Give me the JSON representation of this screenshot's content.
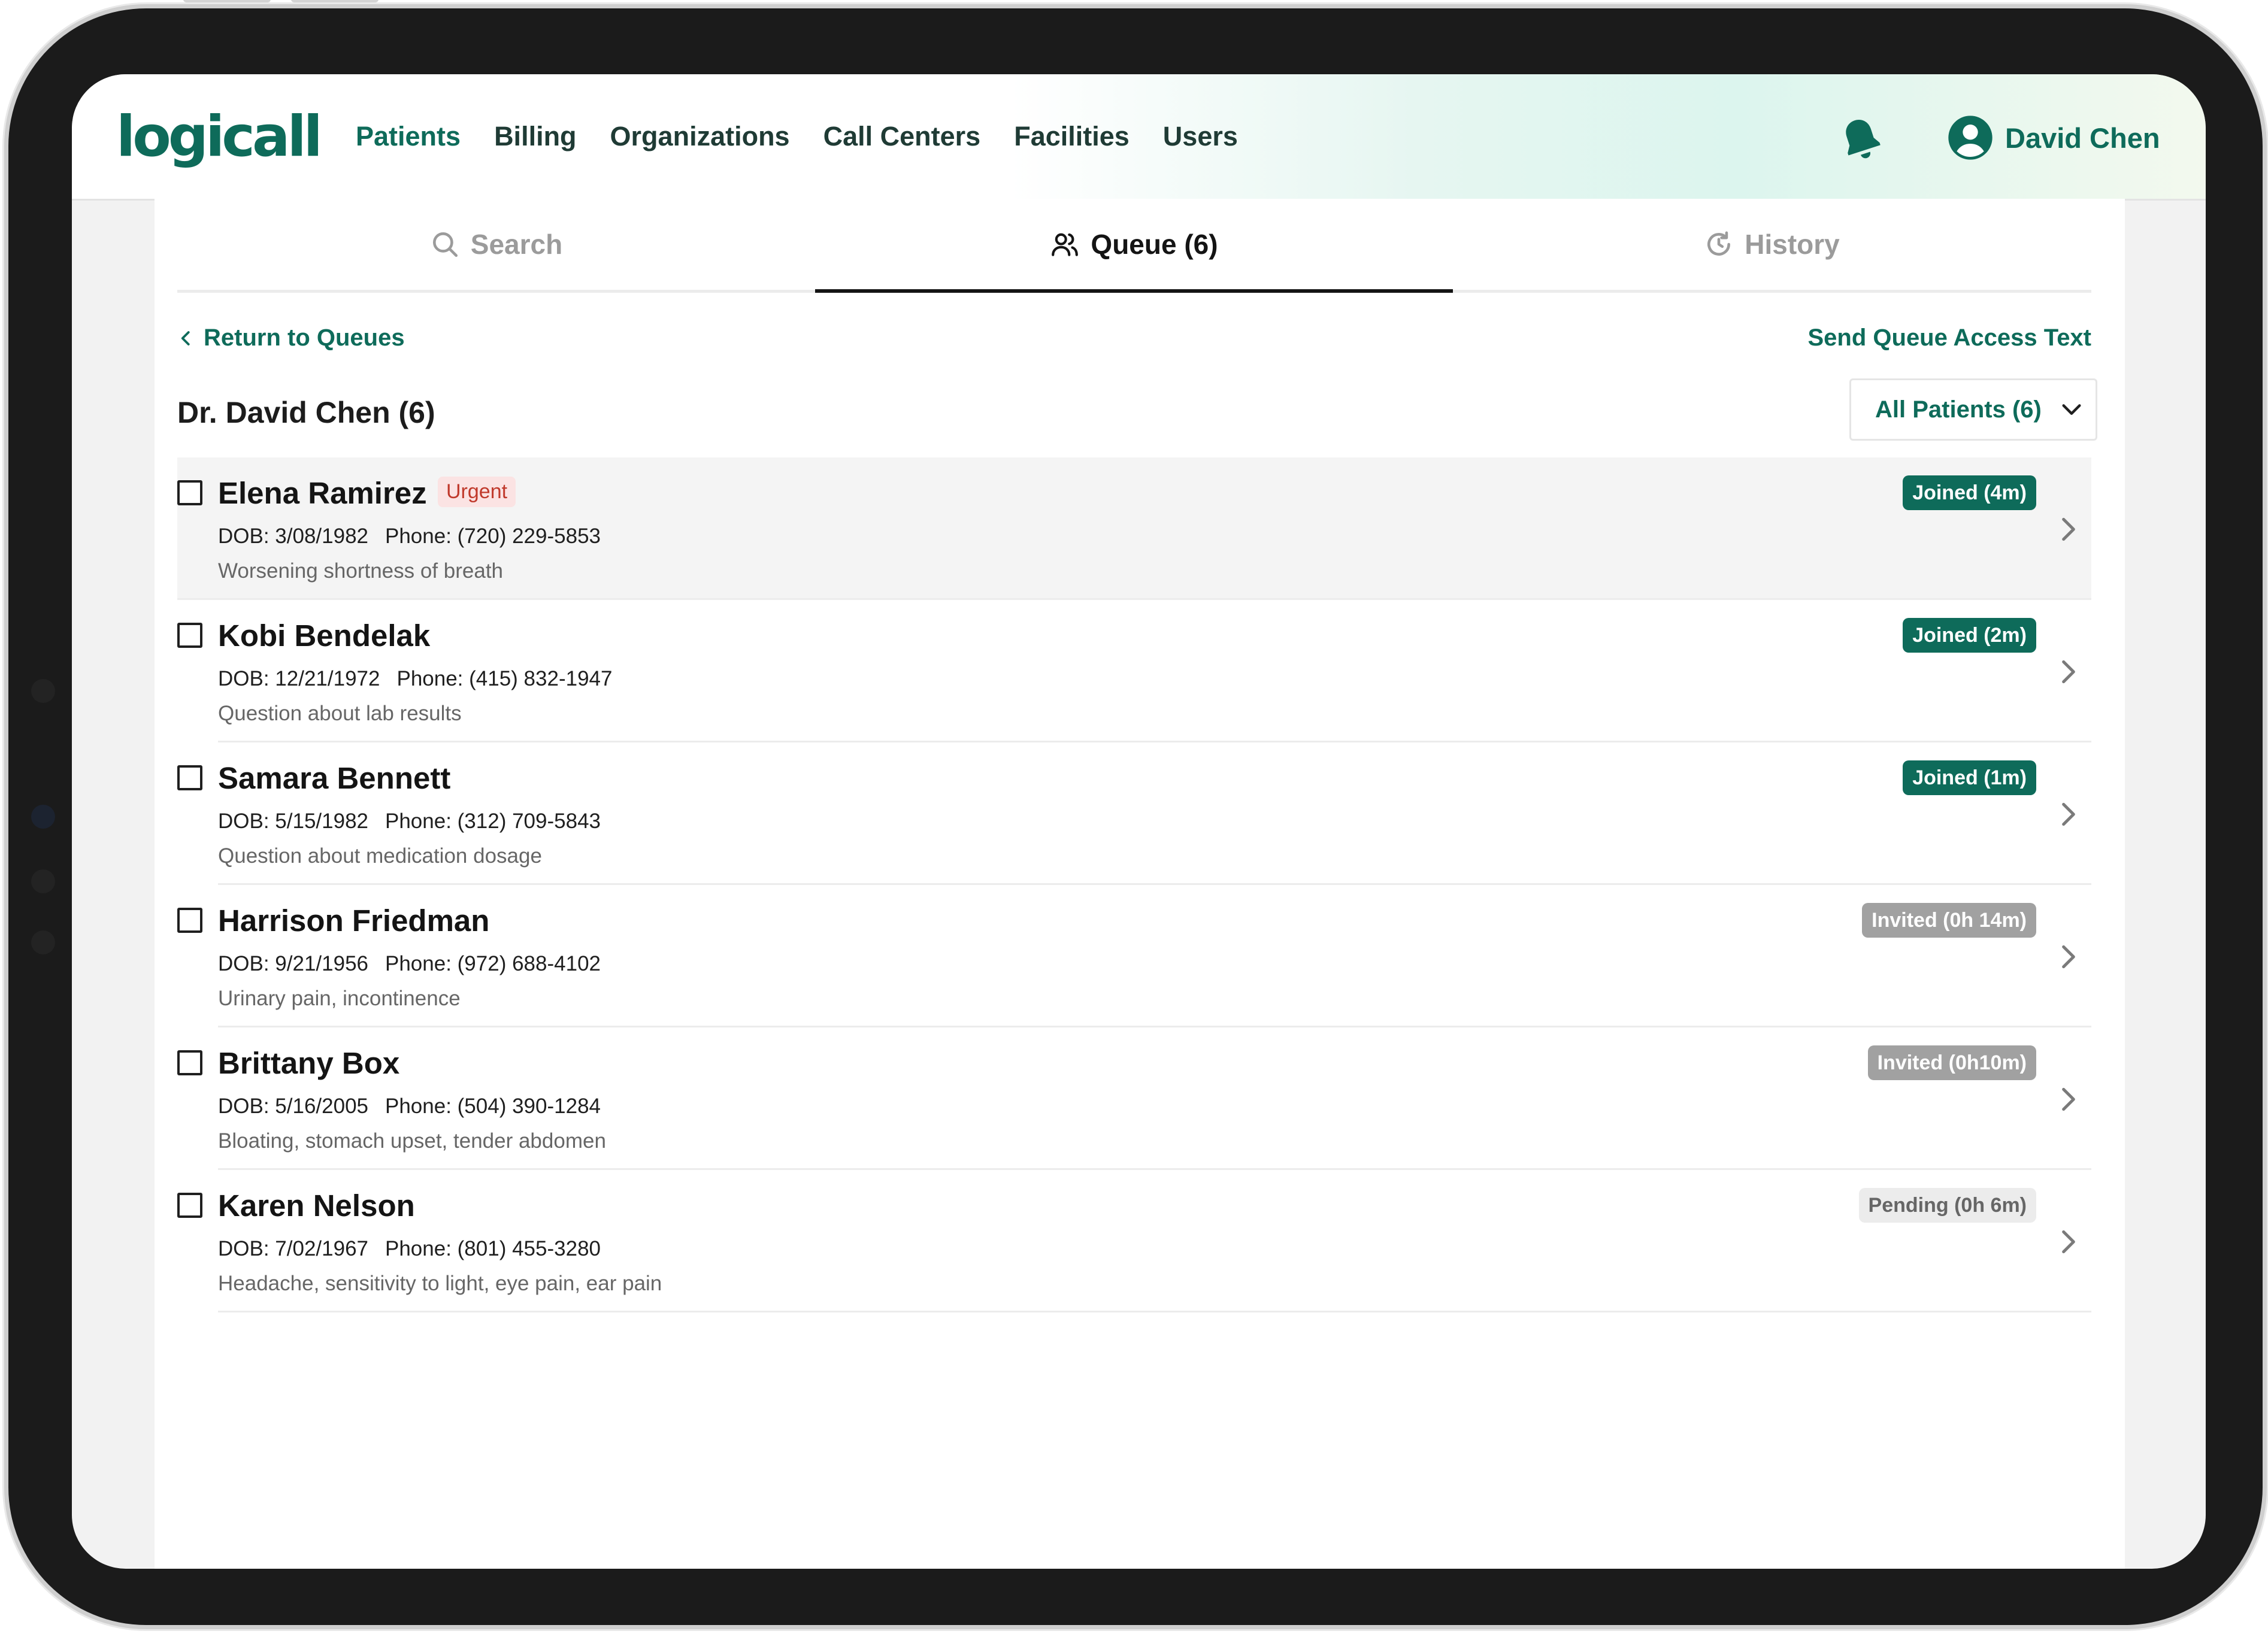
{
  "header": {
    "logo": "logicall",
    "nav": [
      "Patients",
      "Billing",
      "Organizations",
      "Call Centers",
      "Facilities",
      "Users"
    ],
    "active_nav": "Patients",
    "user_name": "David Chen",
    "icons": [
      "bell-icon",
      "user-avatar-icon"
    ]
  },
  "tabs": [
    {
      "label": "Search",
      "icon": "search-icon"
    },
    {
      "label": "Queue (6)",
      "icon": "users-icon",
      "active": true
    },
    {
      "label": "History",
      "icon": "history-icon"
    }
  ],
  "queue": {
    "return_label": "Return to Queues",
    "send_label": "Send Queue Access Text",
    "title": "Dr. David Chen (6)",
    "filter_label": "All Patients (6)"
  },
  "patients": [
    {
      "name": "Elena Ramirez",
      "tag": "Urgent",
      "dob": "DOB: 3/08/1982",
      "phone": "Phone: (720) 229-5853",
      "reason": "Worsening shortness of breath",
      "status": "Joined (4m)",
      "status_type": "joined"
    },
    {
      "name": "Kobi Bendelak",
      "tag": "",
      "dob": "DOB: 12/21/1972",
      "phone": "Phone: (415) 832-1947",
      "reason": "Question about lab results",
      "status": "Joined (2m)",
      "status_type": "joined"
    },
    {
      "name": "Samara Bennett",
      "tag": "",
      "dob": "DOB: 5/15/1982",
      "phone": "Phone: (312) 709-5843",
      "reason": "Question about medication dosage",
      "status": "Joined (1m)",
      "status_type": "joined"
    },
    {
      "name": "Harrison Friedman",
      "tag": "",
      "dob": "DOB: 9/21/1956",
      "phone": "Phone: (972) 688-4102",
      "reason": "Urinary pain, incontinence",
      "status": "Invited (0h 14m)",
      "status_type": "invited"
    },
    {
      "name": "Brittany Box",
      "tag": "",
      "dob": "DOB: 5/16/2005",
      "phone": "Phone: (504) 390-1284",
      "reason": "Bloating, stomach upset, tender abdomen",
      "status": "Invited (0h10m)",
      "status_type": "invited"
    },
    {
      "name": "Karen Nelson",
      "tag": "",
      "dob": "DOB: 7/02/1967",
      "phone": "Phone: (801) 455-3280",
      "reason": "Headache, sensitivity to light, eye pain, ear pain",
      "status": "Pending (0h 6m)",
      "status_type": "pending"
    }
  ],
  "colors": {
    "brand": "#0e6b5a",
    "urgent_bg": "#fbe3e3",
    "urgent_text": "#c0392b",
    "invited": "#a1a1a1"
  }
}
